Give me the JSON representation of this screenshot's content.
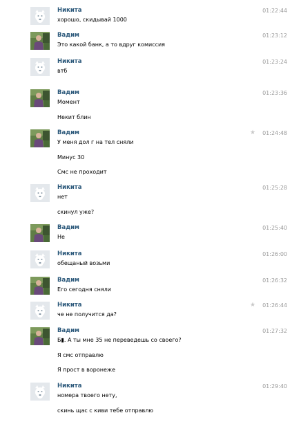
{
  "messages": [
    {
      "sender": "Никита",
      "avatar": "dog",
      "time": "01:22:44",
      "star": false,
      "lines": [
        "хорошо, скидывай 1000"
      ]
    },
    {
      "sender": "Вадим",
      "avatar": "photo",
      "time": "01:23:12",
      "star": false,
      "lines": [
        "Это какой банк, а то вдруг комиссия"
      ]
    },
    {
      "sender": "Никита",
      "avatar": "dog",
      "time": "01:23:24",
      "star": false,
      "lines": [
        "втб"
      ]
    },
    {
      "sender": "Вадим",
      "avatar": "photo",
      "time": "01:23:36",
      "star": false,
      "lines": [
        "Момент",
        "Некит блин"
      ]
    },
    {
      "sender": "Вадим",
      "avatar": "photo",
      "time": "01:24:48",
      "star": true,
      "lines": [
        "У меня дол г на тел сняли",
        "Минус 30",
        "Смс не проходит"
      ]
    },
    {
      "sender": "Никита",
      "avatar": "dog",
      "time": "01:25:28",
      "star": false,
      "lines": [
        "нет",
        "скинул уже?"
      ]
    },
    {
      "sender": "Вадим",
      "avatar": "photo",
      "time": "01:25:40",
      "star": false,
      "lines": [
        "Не"
      ]
    },
    {
      "sender": "Никита",
      "avatar": "dog",
      "time": "01:26:00",
      "star": false,
      "lines": [
        "обещаный возьми"
      ]
    },
    {
      "sender": "Вадим",
      "avatar": "photo",
      "time": "01:26:32",
      "star": false,
      "lines": [
        "Его сегодня сняли"
      ]
    },
    {
      "sender": "Никита",
      "avatar": "dog",
      "time": "01:26:44",
      "star": true,
      "lines": [
        "че не получится да?"
      ]
    },
    {
      "sender": "Вадим",
      "avatar": "photo",
      "time": "01:27:32",
      "star": false,
      "lines": [
        "Б▮. А ты мне 35 не переведешь со своего?",
        "Я смс отправлю",
        "Я прост в воронеже"
      ]
    },
    {
      "sender": "Никита",
      "avatar": "dog",
      "time": "01:29:40",
      "star": false,
      "lines": [
        "номера твоего нету,",
        "скинь щас с киви тебе отправлю"
      ]
    }
  ],
  "icons": {
    "star": "star-icon",
    "dog_avatar": "dog-avatar-icon",
    "photo_avatar": "user-photo-avatar"
  },
  "colors": {
    "name": "#2b587a",
    "time": "#999999",
    "background": "#ffffff"
  }
}
